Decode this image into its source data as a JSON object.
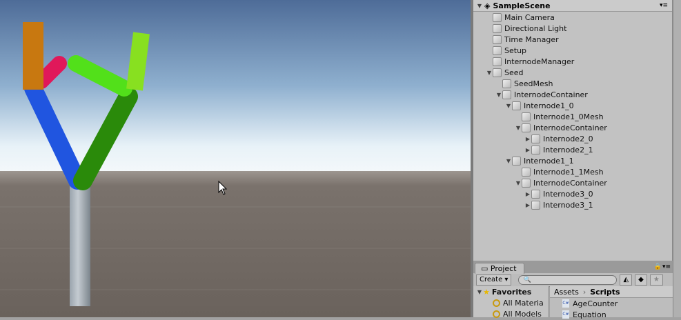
{
  "hierarchy": {
    "scene_name": "SampleScene",
    "items": [
      {
        "label": "Main Camera",
        "depth": 0,
        "expand": ""
      },
      {
        "label": "Directional Light",
        "depth": 0,
        "expand": ""
      },
      {
        "label": "Time Manager",
        "depth": 0,
        "expand": ""
      },
      {
        "label": "Setup",
        "depth": 0,
        "expand": ""
      },
      {
        "label": "InternodeManager",
        "depth": 0,
        "expand": ""
      },
      {
        "label": "Seed",
        "depth": 0,
        "expand": "open"
      },
      {
        "label": "SeedMesh",
        "depth": 1,
        "expand": ""
      },
      {
        "label": "InternodeContainer",
        "depth": 1,
        "expand": "open"
      },
      {
        "label": "Internode1_0",
        "depth": 2,
        "expand": "open"
      },
      {
        "label": "Internode1_0Mesh",
        "depth": 3,
        "expand": ""
      },
      {
        "label": "InternodeContainer",
        "depth": 3,
        "expand": "open"
      },
      {
        "label": "Internode2_0",
        "depth": 4,
        "expand": "closed"
      },
      {
        "label": "Internode2_1",
        "depth": 4,
        "expand": "closed"
      },
      {
        "label": "Internode1_1",
        "depth": 2,
        "expand": "open"
      },
      {
        "label": "Internode1_1Mesh",
        "depth": 3,
        "expand": ""
      },
      {
        "label": "InternodeContainer",
        "depth": 3,
        "expand": "open"
      },
      {
        "label": "Internode3_0",
        "depth": 4,
        "expand": "closed"
      },
      {
        "label": "Internode3_1",
        "depth": 4,
        "expand": "closed"
      }
    ]
  },
  "project": {
    "tab": "Project",
    "create": "Create",
    "search_placeholder": "",
    "favorites": "Favorites",
    "fav_items": [
      "All Materia",
      "All Models"
    ],
    "breadcrumb": [
      "Assets",
      "Scripts"
    ],
    "files": [
      "AgeCounter",
      "Equation"
    ]
  }
}
